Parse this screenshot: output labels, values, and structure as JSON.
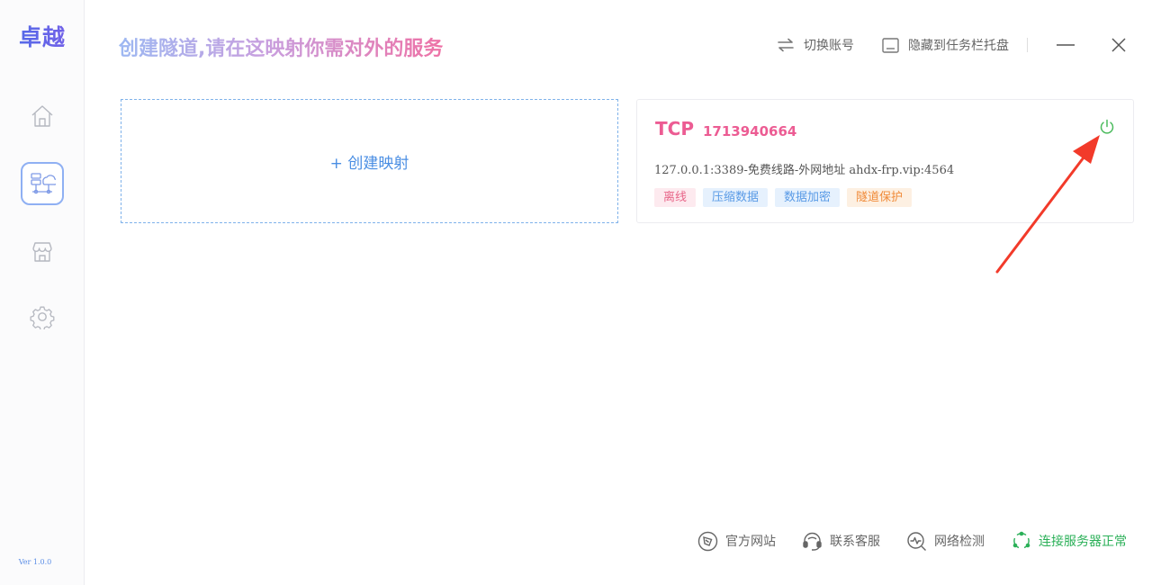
{
  "app": {
    "logo": "卓越",
    "version": "Ver 1.0.0"
  },
  "sidebar": {
    "items": [
      {
        "icon": "home-icon",
        "active": false
      },
      {
        "icon": "tunnel-mapping-icon",
        "active": true
      },
      {
        "icon": "store-icon",
        "active": false
      },
      {
        "icon": "gear-icon",
        "active": false
      }
    ]
  },
  "header": {
    "title": "创建隧道,请在这映射你需对外的服务",
    "switch_account": "切换账号",
    "hide_to_tray": "隐藏到任务栏托盘"
  },
  "create_card": {
    "label": "+ 创建映射"
  },
  "tunnel": {
    "protocol": "TCP",
    "id": "1713940664",
    "address": "127.0.0.1:3389-免费线路-外网地址 ahdx-frp.vip:4564",
    "tags": [
      {
        "label": "离线",
        "color": "#e8678a",
        "bg": "#fdeaef"
      },
      {
        "label": "压缩数据",
        "color": "#5a9be6",
        "bg": "#e6f1fd"
      },
      {
        "label": "数据加密",
        "color": "#5a9be6",
        "bg": "#e6f1fd"
      },
      {
        "label": "隧道保护",
        "color": "#f08b3a",
        "bg": "#fdf0e2"
      }
    ],
    "power_color": "#4cbb5e"
  },
  "footer": {
    "website": "官方网站",
    "support": "联系客服",
    "network_check": "网络检测",
    "server_status": "连接服务器正常"
  },
  "colors": {
    "accent": "#4a8ee3",
    "pink": "#ec5c93",
    "success": "#2bb058",
    "annotation_arrow": "#f23a2a"
  }
}
